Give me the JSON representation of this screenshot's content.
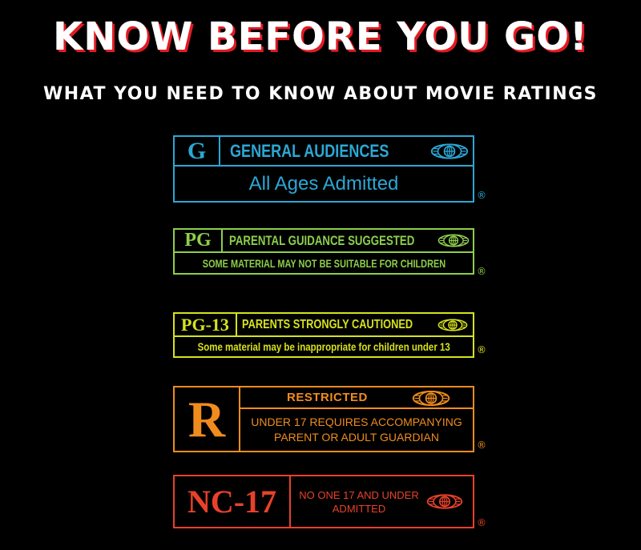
{
  "header": {
    "title": "KNOW BEFORE YOU GO!",
    "subtitle": "WHAT YOU NEED TO KNOW ABOUT MOVIE RATINGS"
  },
  "colors": {
    "g": "#2ba7d5",
    "pg": "#8dcf4a",
    "pg13": "#d6e21c",
    "r": "#f08c1d",
    "nc17": "#e8412a",
    "title_shadow": "#e21b23"
  },
  "ratings": [
    {
      "code": "G",
      "heading": "GENERAL AUDIENCES",
      "description": "All Ages Admitted",
      "reg": "®",
      "icon": "mpa-globe-icon"
    },
    {
      "code": "PG",
      "heading": "PARENTAL GUIDANCE SUGGESTED",
      "description": "SOME MATERIAL MAY NOT BE SUITABLE FOR CHILDREN",
      "reg": "®",
      "icon": "mpa-globe-icon"
    },
    {
      "code": "PG-13",
      "heading": "PARENTS STRONGLY CAUTIONED",
      "description": "Some material may be inappropriate for children under 13",
      "reg": "®",
      "icon": "mpa-globe-icon"
    },
    {
      "code": "R",
      "heading": "RESTRICTED",
      "description_line1": "UNDER 17 REQUIRES ACCOMPANYING",
      "description_line2": "PARENT OR ADULT GUARDIAN",
      "reg": "®",
      "icon": "mpa-globe-icon"
    },
    {
      "code": "NC-17",
      "description_line1": "NO ONE 17 AND UNDER",
      "description_line2": "ADMITTED",
      "reg": "®",
      "icon": "mpa-globe-icon"
    }
  ]
}
